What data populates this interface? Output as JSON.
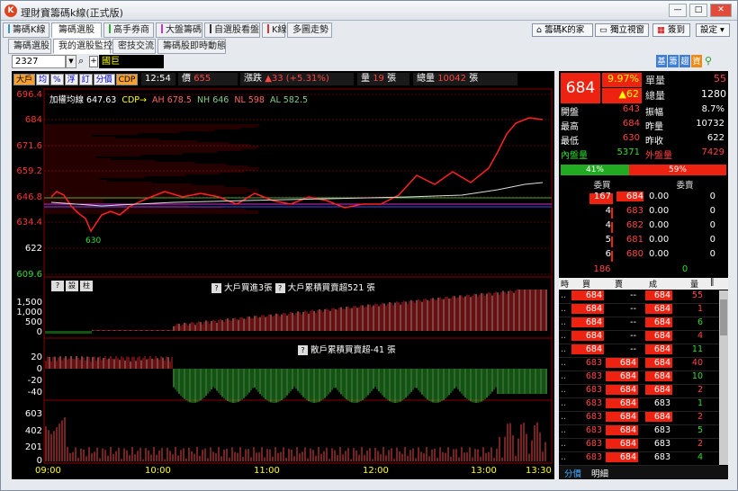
{
  "window": {
    "title": "理財寶籌碼k線(正式版)",
    "btn_min": "—",
    "btn_max": "□",
    "btn_close": "✕"
  },
  "tabs": [
    "籌碼K線",
    "籌碼選股",
    "高手券商",
    "大盤籌碼",
    "自選股看盤",
    "K線",
    "多圖走勢"
  ],
  "right_buttons": [
    "籌碼K的家",
    "獨立視窗",
    "簽到",
    "設定"
  ],
  "subtabs": [
    "籌碼選股",
    "我的選股監控",
    "密技交流",
    "籌碼股即時動態"
  ],
  "toolbar": {
    "code": "2327",
    "name": "國巨",
    "icons": [
      "基",
      "籌",
      "趨",
      "資"
    ]
  },
  "chart": {
    "buttons": [
      "大戶",
      "均",
      "%",
      "浮",
      "訂",
      "分價",
      "CDP"
    ],
    "time": "12:54",
    "price_label": "價",
    "price": "655",
    "change_label": "漲跌",
    "change": "▲33 (+5.31%)",
    "vol_label": "量",
    "vol": "19",
    "vol_unit": "張",
    "total_label": "總量",
    "total": "10042",
    "total_unit": "張",
    "legend": {
      "avg_label": "加權均線",
      "avg": "647.63",
      "cdp": "CDP→",
      "ah": "AH 678.5",
      "nh": "NH 646",
      "nl": "NL 598",
      "al": "AL 582.5"
    },
    "y_labels": [
      "696.4",
      "684",
      "671.6",
      "659.2",
      "646.8",
      "634.4",
      "622",
      "609.6"
    ],
    "low_mark": "630",
    "big_title": "大戶買進3張",
    "big_title2": "大戶累積買賣超521 張",
    "big_y": [
      "1,500",
      "1,000",
      "500",
      "0"
    ],
    "retail_title": "散戶累積買賣超-41 張",
    "retail_y": [
      "20",
      "0",
      "-20",
      "-40"
    ],
    "vol_y": [
      "603",
      "402",
      "201",
      "0"
    ],
    "x_labels": [
      "09:00",
      "10:00",
      "11:00",
      "12:00",
      "13:00",
      "13:30"
    ],
    "mini_btns": [
      "?",
      "設",
      "柱"
    ]
  },
  "quote": {
    "price": "684",
    "pct": "9.97%",
    "chg": "▲62",
    "rows": [
      {
        "k": "單量",
        "v": "55",
        "k2": "",
        "v2": ""
      },
      {
        "k": "總量",
        "v": "1280",
        "k2": "",
        "v2": ""
      }
    ],
    "stats": [
      {
        "a": "開盤",
        "b": "643",
        "c": "振幅",
        "d": "8.7%"
      },
      {
        "a": "最高",
        "b": "684",
        "c": "昨量",
        "d": "10732"
      },
      {
        "a": "最低",
        "b": "630",
        "c": "昨收",
        "d": "622"
      },
      {
        "a": "內盤量",
        "b": "5371",
        "c": "外盤量",
        "d": "7429"
      }
    ],
    "ratio_left": "41%",
    "ratio_right": "59%",
    "bid_head": "委買",
    "ask_head": "委賣",
    "book": [
      {
        "bq": "167",
        "bp": "684",
        "ap": "0.00",
        "aq": "0"
      },
      {
        "bq": "4",
        "bp": "683",
        "ap": "0.00",
        "aq": "0"
      },
      {
        "bq": "4",
        "bp": "682",
        "ap": "0.00",
        "aq": "0"
      },
      {
        "bq": "5",
        "bp": "681",
        "ap": "0.00",
        "aq": "0"
      },
      {
        "bq": "6",
        "bp": "680",
        "ap": "0.00",
        "aq": "0"
      }
    ],
    "sum_b": "186",
    "sum_a": "0",
    "tick_head": [
      "時",
      "買",
      "賣",
      "成",
      "量",
      "‖"
    ],
    "ticks": [
      {
        "b": "684",
        "s": "--",
        "p": "684",
        "q": "55"
      },
      {
        "b": "684",
        "s": "--",
        "p": "684",
        "q": "1"
      },
      {
        "b": "684",
        "s": "--",
        "p": "684",
        "q": "6"
      },
      {
        "b": "684",
        "s": "--",
        "p": "684",
        "q": "4"
      },
      {
        "b": "684",
        "s": "--",
        "p": "684",
        "q": "11"
      },
      {
        "b": "683",
        "s": "684",
        "p": "684",
        "q": "40"
      },
      {
        "b": "683",
        "s": "684",
        "p": "684",
        "q": "10"
      },
      {
        "b": "683",
        "s": "684",
        "p": "684",
        "q": "2"
      },
      {
        "b": "683",
        "s": "684",
        "p": "683",
        "q": "1"
      },
      {
        "b": "683",
        "s": "684",
        "p": "684",
        "q": "2"
      },
      {
        "b": "683",
        "s": "684",
        "p": "683",
        "q": "5"
      },
      {
        "b": "683",
        "s": "684",
        "p": "683",
        "q": "2"
      },
      {
        "b": "683",
        "s": "684",
        "p": "683",
        "q": "4"
      }
    ],
    "foot": [
      "分價",
      "明細"
    ]
  }
}
